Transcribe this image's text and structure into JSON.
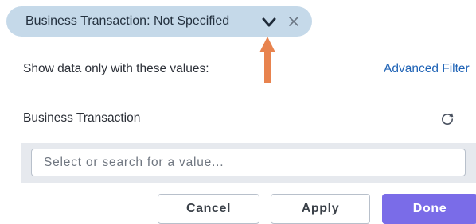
{
  "filter_chip": {
    "label": "Business Transaction: Not Specified",
    "expand_icon": "chevron-down-icon",
    "remove_icon": "close-icon"
  },
  "annotation": {
    "icon": "arrow-up-icon",
    "color": "#e8834e"
  },
  "filter_panel": {
    "caption": "Show data only with these values:",
    "advanced_link": "Advanced Filter",
    "section_title": "Business Transaction",
    "refresh_icon": "refresh-icon",
    "search": {
      "value": "",
      "placeholder": "Select or search for a value..."
    }
  },
  "actions": {
    "cancel_label": "Cancel",
    "apply_label": "Apply",
    "done_label": "Done"
  },
  "colors": {
    "chip_background": "#c5d9e9",
    "link": "#1f63b6",
    "primary_button": "#7a6ce8",
    "annotation_arrow": "#e8834e"
  }
}
